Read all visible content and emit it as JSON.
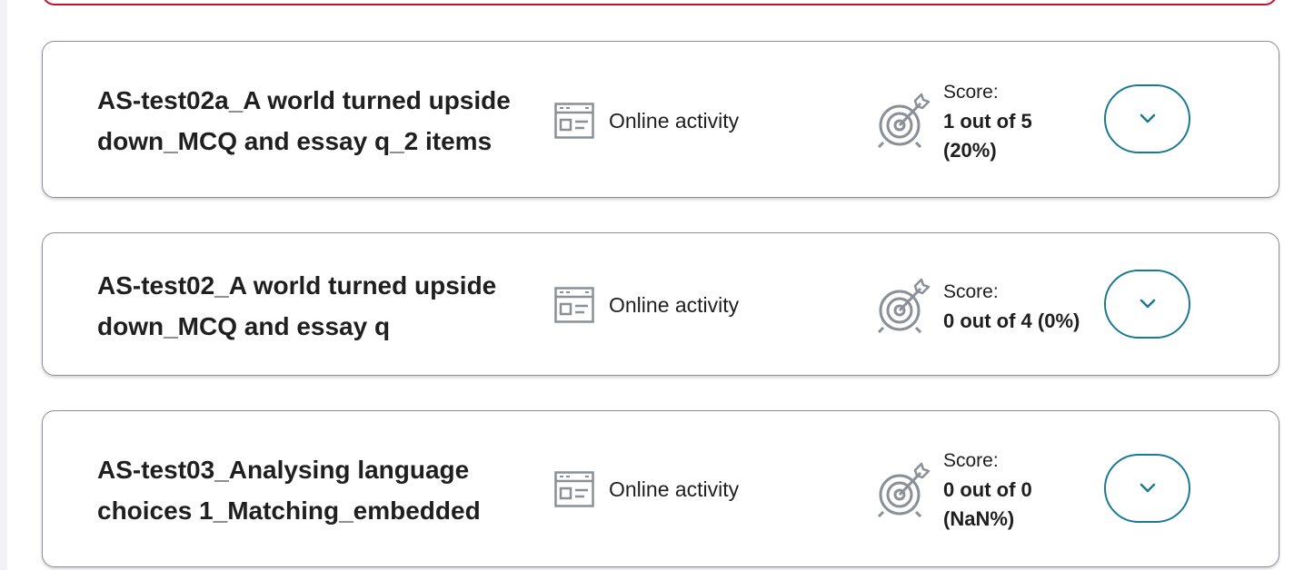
{
  "activities": [
    {
      "title_line1": "AS-test02a_A world turned upside",
      "title_line2": "down_MCQ and essay q_2 items",
      "type_label": "Online activity",
      "score_label": "Score:",
      "score_line1": "1 out of 5",
      "score_line2": "(20%)"
    },
    {
      "title_line1": "AS-test02_A world turned upside",
      "title_line2": "down_MCQ and essay q",
      "type_label": "Online activity",
      "score_label": "Score:",
      "score_line1": "0 out of 4 (0%)",
      "score_line2": ""
    },
    {
      "title_line1": "AS-test03_Analysing language",
      "title_line2": "choices 1_Matching_embedded",
      "type_label": "Online activity",
      "score_label": "Score:",
      "score_line1": "0 out of 0",
      "score_line2": "(NaN%)"
    }
  ],
  "icons": {
    "activity": "online-activity-icon",
    "score": "target-icon",
    "expand": "chevron-down-icon"
  },
  "colors": {
    "accent": "#1a7a93",
    "card_border": "#8a8f98",
    "previous_card_border": "#c8102e",
    "icon_gray": "#8a8f98",
    "text": "#1f1f1f"
  }
}
